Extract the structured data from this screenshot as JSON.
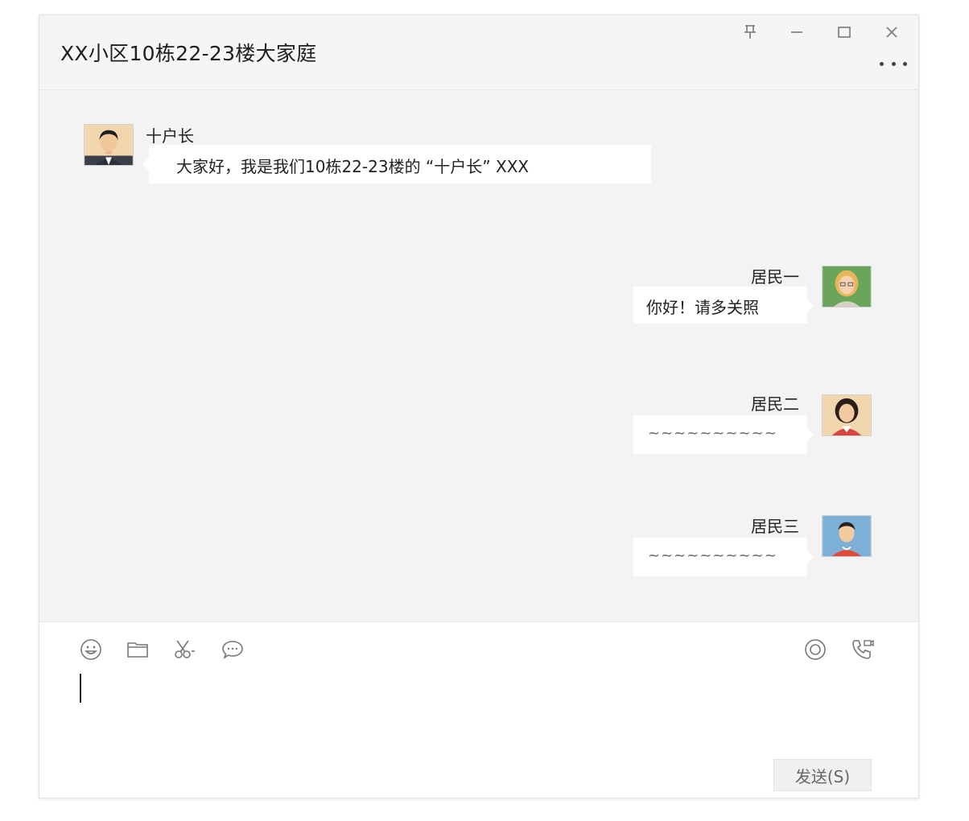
{
  "window": {
    "title": "XX小区10栋22-23楼大家庭",
    "controls": {
      "pin_icon": "pin-icon",
      "minimize_icon": "minimize-icon",
      "maximize_icon": "maximize-icon",
      "close_icon": "close-icon",
      "more_icon": "more-icon"
    }
  },
  "messages": [
    {
      "sender": "十户长",
      "text": "大家好，我是我们10栋22-23楼的 “十户长” XXX",
      "side": "left",
      "avatar": "male-suit-avatar"
    },
    {
      "sender": "居民一",
      "text": "你好！请多关照",
      "side": "right",
      "avatar": "female-glasses-avatar"
    },
    {
      "sender": "居民二",
      "text": "~~~~~~~~~~",
      "side": "right",
      "avatar": "female-dark-hair-avatar"
    },
    {
      "sender": "居民三",
      "text": "~~~~~~~~~~",
      "side": "right",
      "avatar": "male-avatar"
    }
  ],
  "composer": {
    "tools": [
      "emoji-icon",
      "folder-icon",
      "scissors-icon",
      "chat-bubble-icon"
    ],
    "right_tools": [
      "live-icon",
      "call-icon"
    ],
    "input_value": "",
    "send_label": "发送(S)"
  },
  "colors": {
    "chat_background": "#f3f3f3",
    "bubble": "#ffffff",
    "composer_background": "#ffffff"
  }
}
